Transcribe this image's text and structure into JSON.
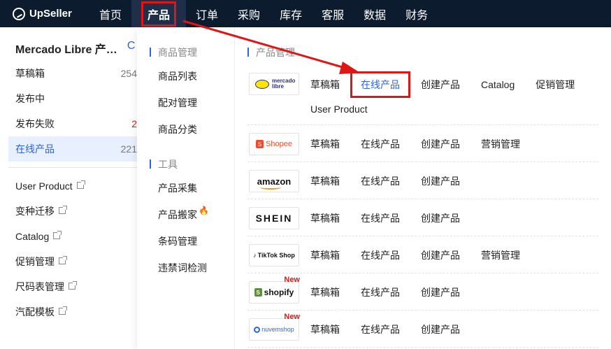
{
  "app": {
    "logo_text": "UpSeller"
  },
  "nav": {
    "items": [
      {
        "label": "首页"
      },
      {
        "label": "产品",
        "active": true
      },
      {
        "label": "订单"
      },
      {
        "label": "采购"
      },
      {
        "label": "库存"
      },
      {
        "label": "客服"
      },
      {
        "label": "数据"
      },
      {
        "label": "财务"
      }
    ]
  },
  "sidebar": {
    "title": "Mercado Libre 产…",
    "status_items": [
      {
        "label": "草稿箱",
        "count": "254"
      },
      {
        "label": "发布中",
        "count": ""
      },
      {
        "label": "发布失败",
        "count": "2"
      },
      {
        "label": "在线产品",
        "count": "221"
      }
    ],
    "link_items": [
      {
        "label": "User Product"
      },
      {
        "label": "变种迁移"
      },
      {
        "label": "Catalog"
      },
      {
        "label": "促销管理"
      },
      {
        "label": "尺码表管理"
      },
      {
        "label": "汽配模板"
      }
    ]
  },
  "menu": {
    "group1_title": "商品管理",
    "group1_items": [
      "商品列表",
      "配对管理",
      "商品分类"
    ],
    "group2_title": "工具",
    "group2_items": [
      "产品采集",
      "产品搬家",
      "条码管理",
      "违禁词检测"
    ],
    "col2_title": "产品管理",
    "new_badge": "New",
    "platforms": [
      {
        "logo": "mercado libre",
        "links": [
          "草稿箱",
          "在线产品",
          "创建产品",
          "Catalog",
          "促销管理",
          "User Product"
        ]
      },
      {
        "logo": "Shopee",
        "links": [
          "草稿箱",
          "在线产品",
          "创建产品",
          "营销管理"
        ]
      },
      {
        "logo": "amazon",
        "links": [
          "草稿箱",
          "在线产品",
          "创建产品"
        ]
      },
      {
        "logo": "SHEIN",
        "links": [
          "草稿箱",
          "在线产品",
          "创建产品"
        ]
      },
      {
        "logo": "TikTok Shop",
        "links": [
          "草稿箱",
          "在线产品",
          "创建产品",
          "营销管理"
        ]
      },
      {
        "logo": "shopify",
        "links": [
          "草稿箱",
          "在线产品",
          "创建产品"
        ]
      },
      {
        "logo": "nuvemshop",
        "links": [
          "草稿箱",
          "在线产品",
          "创建产品"
        ]
      }
    ]
  },
  "colors": {
    "accent": "#2b63e0",
    "highlight": "#e01515",
    "topbar": "#0d1b2e"
  }
}
